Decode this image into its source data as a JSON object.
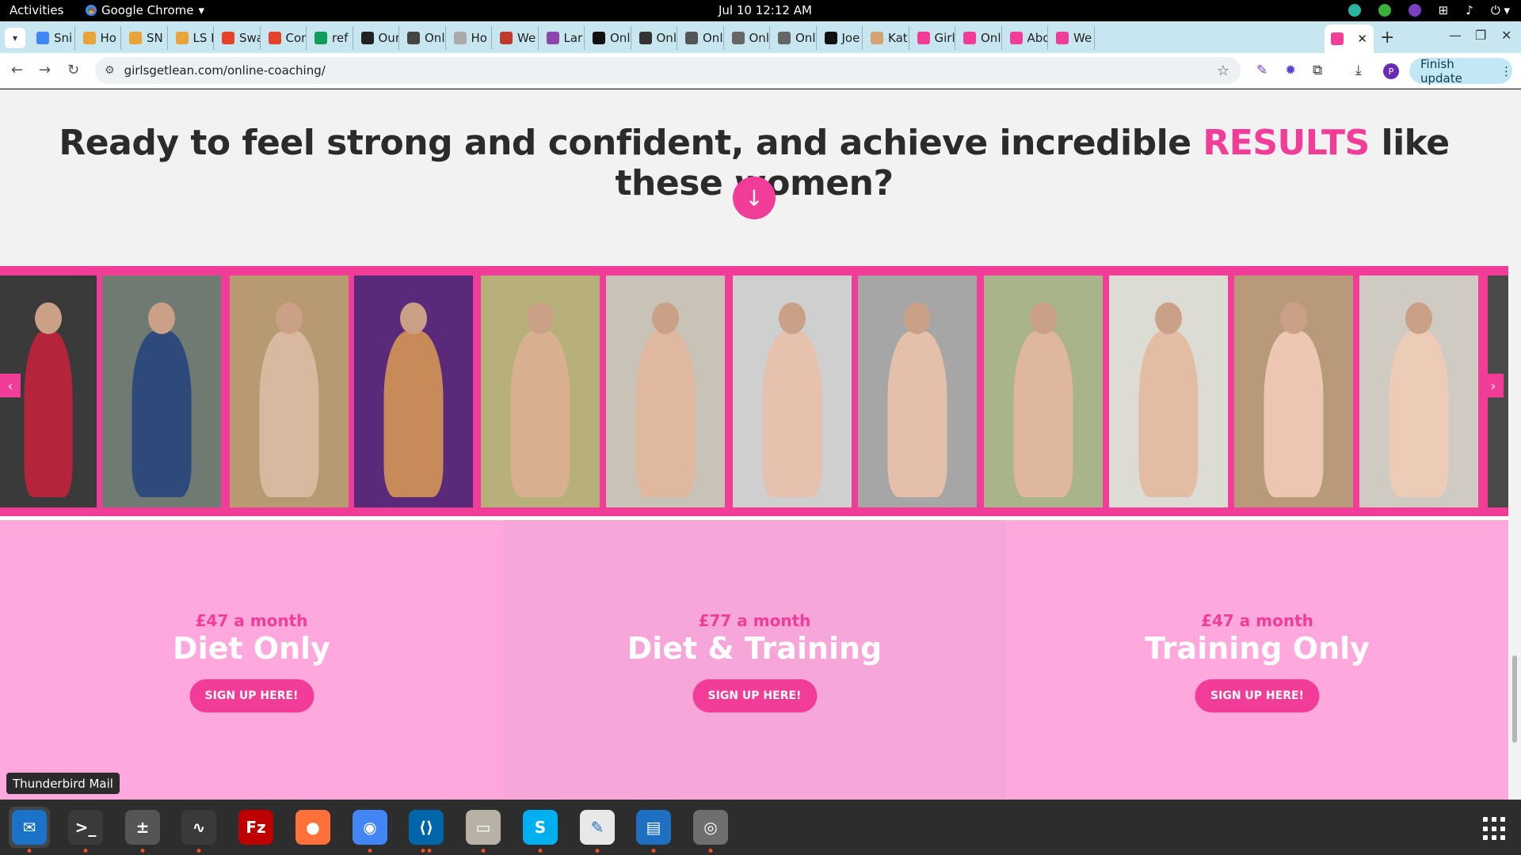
{
  "system_bar": {
    "activities": "Activities",
    "app_name": "Google Chrome",
    "clock": "Jul 10  12:12 AM"
  },
  "tabs": [
    {
      "label": "Sni",
      "color": "#4285f4"
    },
    {
      "label": "Ho",
      "color": "#e8a33a"
    },
    {
      "label": "SN",
      "color": "#e8a33a"
    },
    {
      "label": "LS F",
      "color": "#e8a33a"
    },
    {
      "label": "Swa",
      "color": "#e24329"
    },
    {
      "label": "Con",
      "color": "#e24329"
    },
    {
      "label": "ref",
      "color": "#0f9d58"
    },
    {
      "label": "Our",
      "color": "#222222"
    },
    {
      "label": "Onl",
      "color": "#444444"
    },
    {
      "label": "Ho",
      "color": "#aaaaaa"
    },
    {
      "label": "We",
      "color": "#c0392b"
    },
    {
      "label": "Lar",
      "color": "#8e44ad"
    },
    {
      "label": "Onl",
      "color": "#111111"
    },
    {
      "label": "Onl",
      "color": "#333333"
    },
    {
      "label": "Onl",
      "color": "#555555"
    },
    {
      "label": "Onl",
      "color": "#666666"
    },
    {
      "label": "Onl",
      "color": "#666666"
    },
    {
      "label": "Joe",
      "color": "#111111"
    },
    {
      "label": "Kat",
      "color": "#d4a373"
    },
    {
      "label": "Girl",
      "color": "#f23d98"
    },
    {
      "label": "Onl",
      "color": "#f23d98"
    },
    {
      "label": "Abo",
      "color": "#f23d98"
    },
    {
      "label": "We",
      "color": "#f23d98"
    }
  ],
  "active_tab": {
    "label": "",
    "color": "#f23d98"
  },
  "browser": {
    "url": "girlsgetlean.com/online-coaching/",
    "finish_update": "Finish update",
    "profile_initial": "P"
  },
  "page": {
    "headline_before": "Ready to feel strong and confident, and achieve incredible ",
    "headline_accent": "RESULTS",
    "headline_after": " like these women?",
    "accent_color": "#f23d98",
    "gallery_prev": "‹",
    "gallery_next": "›",
    "plans": [
      {
        "price": "£47 a month",
        "name": "Diet Only",
        "button": "SIGN UP HERE!",
        "bg": "#ffa8dd"
      },
      {
        "price": "£77 a month",
        "name": "Diet & Training",
        "button": "SIGN UP HERE!",
        "bg": "#f7a6d9"
      },
      {
        "price": "£47 a month",
        "name": "Training Only",
        "button": "SIGN UP HERE!",
        "bg": "#ffa8dd"
      }
    ]
  },
  "tooltip": "Thunderbird Mail",
  "dock": [
    {
      "name": "thunderbird-icon",
      "glyph": "✉",
      "bg": "#1a73c9",
      "dots": 1
    },
    {
      "name": "terminal-icon",
      "glyph": ">_",
      "bg": "#3a3a3a",
      "dots": 1
    },
    {
      "name": "calculator-icon",
      "glyph": "±",
      "bg": "#555555",
      "dots": 1
    },
    {
      "name": "system-monitor-icon",
      "glyph": "∿",
      "bg": "#3a3a3a",
      "dots": 1
    },
    {
      "name": "filezilla-icon",
      "glyph": "Fz",
      "bg": "#bf0000",
      "dots": 0
    },
    {
      "name": "firefox-icon",
      "glyph": "●",
      "bg": "#ff7139",
      "dots": 0
    },
    {
      "name": "chrome-icon",
      "glyph": "◉",
      "bg": "#4285f4",
      "dots": 1
    },
    {
      "name": "vscode-icon",
      "glyph": "⟨⟩",
      "bg": "#0065a9",
      "dots": 2
    },
    {
      "name": "files-icon",
      "glyph": "▭",
      "bg": "#b8b2a6",
      "dots": 1
    },
    {
      "name": "skype-icon",
      "glyph": "S",
      "bg": "#00aff0",
      "dots": 1
    },
    {
      "name": "text-editor-icon",
      "glyph": "✎",
      "bg": "#e8e8e8",
      "dots": 1
    },
    {
      "name": "writer-icon",
      "glyph": "▤",
      "bg": "#1e6fc2",
      "dots": 1
    },
    {
      "name": "disc-icon",
      "glyph": "◎",
      "bg": "#6e6e6e",
      "dots": 1
    }
  ]
}
